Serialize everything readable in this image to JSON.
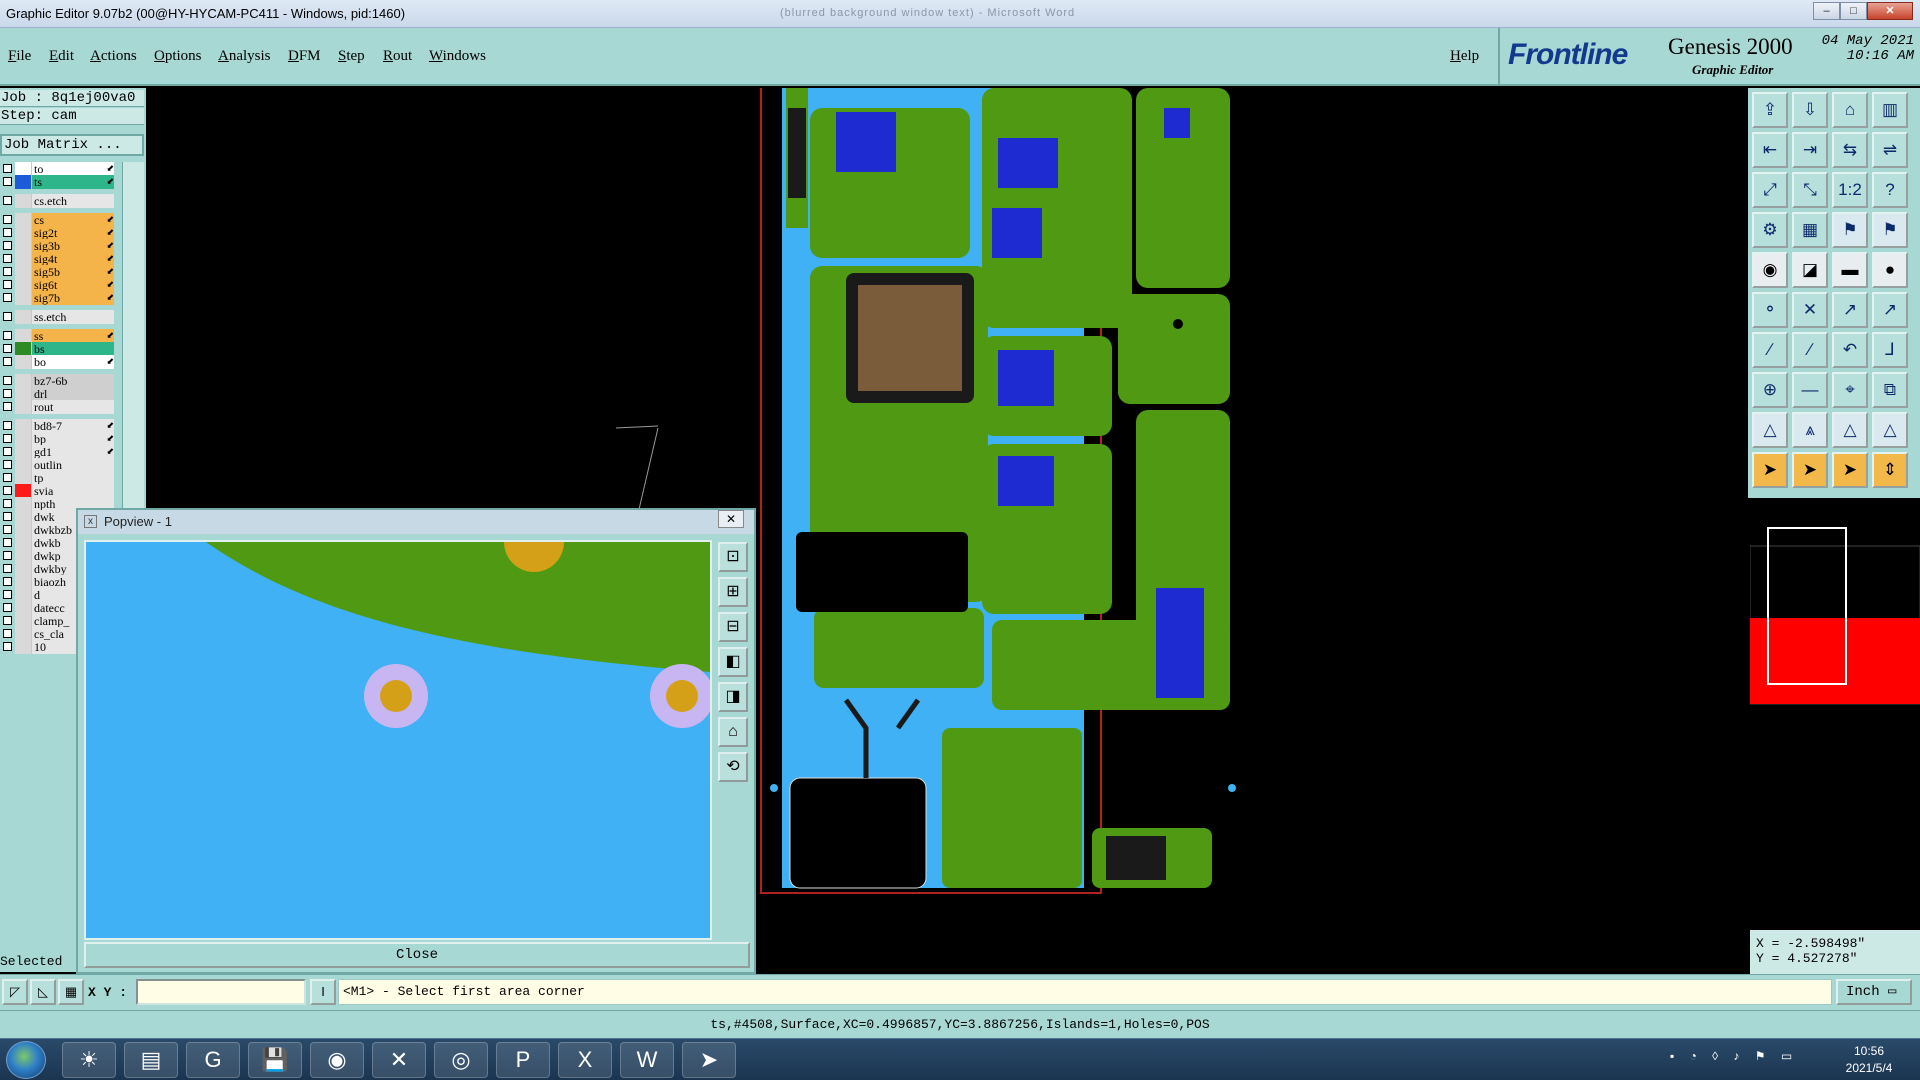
{
  "window": {
    "title": "Graphic Editor 9.07b2 (00@HY-HYCAM-PC411 - Windows, pid:1460)",
    "background_title": "(blurred background window text) - Microsoft Word",
    "min_symbol": "–",
    "max_symbol": "□",
    "close_symbol": "✕"
  },
  "menu": {
    "items": [
      "File",
      "Edit",
      "Actions",
      "Options",
      "Analysis",
      "DFM",
      "Step",
      "Rout",
      "Windows"
    ],
    "help": "Help"
  },
  "brand": {
    "logo": "Frontline",
    "product": "Genesis 2000",
    "subtitle": "Graphic Editor",
    "date": "04 May 2021",
    "time": "10:16 AM"
  },
  "job": {
    "job_line": "Job : 8q1ej00va0",
    "step_line": "Step: cam",
    "matrix_button": "Job Matrix ..."
  },
  "layers": [
    {
      "name": "to",
      "color": "#ffffff",
      "name_bg": "#ffffff",
      "arrow": true
    },
    {
      "name": "ts",
      "color": "#1e5bd8",
      "name_bg": "#2fb58a",
      "arrow": true
    },
    {
      "name": "cs.etch",
      "color": "#d9d9d9",
      "name_bg": "#e6e6e6",
      "arrow": false
    },
    {
      "name": "cs",
      "color": "#d9d9d9",
      "name_bg": "#f5b44a",
      "arrow": true
    },
    {
      "name": "sig2t",
      "color": "#d9d9d9",
      "name_bg": "#f5b44a",
      "arrow": true
    },
    {
      "name": "sig3b",
      "color": "#d9d9d9",
      "name_bg": "#f5b44a",
      "arrow": true
    },
    {
      "name": "sig4t",
      "color": "#d9d9d9",
      "name_bg": "#f5b44a",
      "arrow": true
    },
    {
      "name": "sig5b",
      "color": "#d9d9d9",
      "name_bg": "#f5b44a",
      "arrow": true
    },
    {
      "name": "sig6t",
      "color": "#d9d9d9",
      "name_bg": "#f5b44a",
      "arrow": true
    },
    {
      "name": "sig7b",
      "color": "#d9d9d9",
      "name_bg": "#f5b44a",
      "arrow": true
    },
    {
      "name": "ss.etch",
      "color": "#d9d9d9",
      "name_bg": "#e6e6e6",
      "arrow": false
    },
    {
      "name": "ss",
      "color": "#d9d9d9",
      "name_bg": "#f5b44a",
      "arrow": true
    },
    {
      "name": "bs",
      "color": "#2e8b24",
      "name_bg": "#2fb58a",
      "arrow": false
    },
    {
      "name": "bo",
      "color": "#d9d9d9",
      "name_bg": "#ffffff",
      "arrow": true
    },
    {
      "name": "bz7-6b",
      "color": "#d9d9d9",
      "name_bg": "#cfcfcf",
      "arrow": false
    },
    {
      "name": "drl",
      "color": "#d9d9d9",
      "name_bg": "#cfcfcf",
      "arrow": false
    },
    {
      "name": "rout",
      "color": "#d9d9d9",
      "name_bg": "#e6e6e6",
      "arrow": false
    },
    {
      "name": "bd8-7",
      "color": "#d9d9d9",
      "name_bg": "#e6e6e6",
      "arrow": true
    },
    {
      "name": "bp",
      "color": "#d9d9d9",
      "name_bg": "#e6e6e6",
      "arrow": true
    },
    {
      "name": "gd1",
      "color": "#d9d9d9",
      "name_bg": "#e6e6e6",
      "arrow": true
    },
    {
      "name": "outlin",
      "color": "#d9d9d9",
      "name_bg": "#e6e6e6",
      "arrow": false
    },
    {
      "name": "tp",
      "color": "#d9d9d9",
      "name_bg": "#e6e6e6",
      "arrow": false
    },
    {
      "name": "svia",
      "color": "#ff1a1a",
      "name_bg": "#e6e6e6",
      "arrow": false
    },
    {
      "name": "npth",
      "color": "#d9d9d9",
      "name_bg": "#e6e6e6",
      "arrow": false
    },
    {
      "name": "dwk",
      "color": "#d9d9d9",
      "name_bg": "#e6e6e6",
      "arrow": false
    },
    {
      "name": "dwkbzb",
      "color": "#d9d9d9",
      "name_bg": "#e6e6e6",
      "arrow": false
    },
    {
      "name": "dwkb",
      "color": "#d9d9d9",
      "name_bg": "#e6e6e6",
      "arrow": false
    },
    {
      "name": "dwkp",
      "color": "#d9d9d9",
      "name_bg": "#e6e6e6",
      "arrow": false
    },
    {
      "name": "dwkby",
      "color": "#d9d9d9",
      "name_bg": "#e6e6e6",
      "arrow": false
    },
    {
      "name": "biaozh",
      "color": "#d9d9d9",
      "name_bg": "#e6e6e6",
      "arrow": false
    },
    {
      "name": "d",
      "color": "#d9d9d9",
      "name_bg": "#e6e6e6",
      "arrow": false
    },
    {
      "name": "datecc",
      "color": "#d9d9d9",
      "name_bg": "#e6e6e6",
      "arrow": false
    },
    {
      "name": "clamp_",
      "color": "#d9d9d9",
      "name_bg": "#e6e6e6",
      "arrow": false
    },
    {
      "name": "cs_cla",
      "color": "#d9d9d9",
      "name_bg": "#e6e6e6",
      "arrow": false
    },
    {
      "name": "10",
      "color": "#d9d9d9",
      "name_bg": "#e6e6e6",
      "arrow": false
    }
  ],
  "selected_label": "Selected :",
  "popview": {
    "title": "Popview - 1",
    "close_button": "Close",
    "close_x": "✕",
    "tool_icons": [
      "zoom-fit-icon",
      "zoom-in-icon",
      "zoom-out-icon",
      "pan-left-icon",
      "pan-right-icon",
      "home-icon",
      "redraw-icon"
    ],
    "tool_glyphs": [
      "⊡",
      "⊞",
      "⊟",
      "◧",
      "◨",
      "⌂",
      "⟲"
    ]
  },
  "toolbox": {
    "glyphs": [
      "⇪",
      "⇩",
      "⌂",
      "▥",
      "⇤",
      "⇥",
      "⇆",
      "⇌",
      "⤢",
      "⤡",
      "1:2",
      "?",
      "⚙",
      "▦",
      "⚑",
      "⚑",
      "◉",
      "◪",
      "▬",
      "●",
      "⚬",
      "✕",
      "↗",
      "↗",
      "∕",
      "∕",
      "↶",
      "⅃",
      "⊕",
      "—",
      "⌖",
      "⧉",
      "△",
      "⩓",
      "△",
      "△",
      "➤",
      "➤",
      "➤",
      "⇕"
    ],
    "styles": [
      "",
      "",
      "",
      "",
      "",
      "",
      "",
      "",
      "",
      "",
      "",
      "",
      "",
      "",
      "red",
      "red",
      "blk",
      "blk",
      "blk",
      "blk",
      "",
      "",
      "",
      "",
      "",
      "",
      "",
      "",
      "",
      "",
      "",
      "",
      "red",
      "red",
      "red",
      "red",
      "or",
      "or",
      "or",
      "or"
    ]
  },
  "coordinates": {
    "x": "X = -2.598498\"",
    "y": "Y = 4.527278\""
  },
  "command": {
    "xy_label": "X Y :",
    "xy_value": "",
    "prompt": "<M1> - Select first area corner",
    "unit": "Inch ▭"
  },
  "status": {
    "text": "ts,#4508,Surface,XC=0.4996857,YC=3.8867256,Islands=1,Holes=0,POS"
  },
  "taskbar": {
    "apps": [
      "☀",
      "▤",
      "G",
      "💾",
      "◉",
      "✕",
      "◎",
      "P",
      "X",
      "W",
      "➤"
    ],
    "time": "10:56",
    "date": "2021/5/4"
  },
  "colors": {
    "panel": "#a8d8d4",
    "board_green": "#4f9a12",
    "board_blue": "#3fb1f4",
    "component_blue": "#1d2bd0",
    "pad_gold": "#d4a017",
    "pad_ring": "#c8b6f2"
  }
}
